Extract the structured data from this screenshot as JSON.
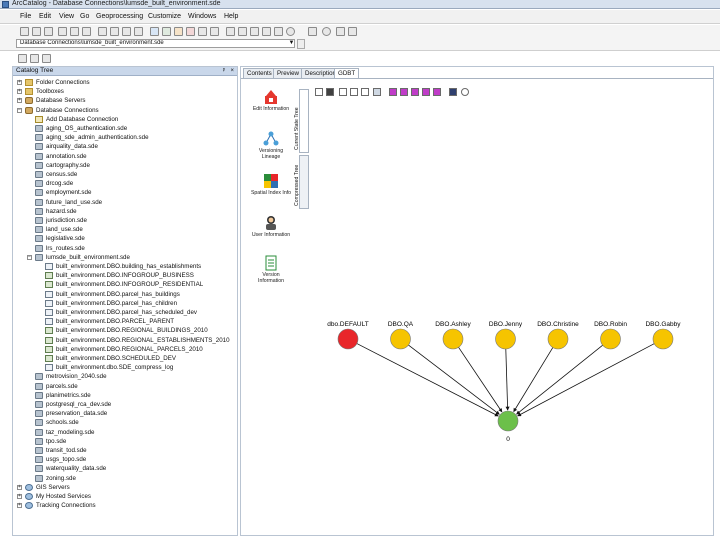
{
  "window": {
    "title": "ArcCatalog - Database Connections\\lumsde_built_environment.sde"
  },
  "menu": [
    "File",
    "Edit",
    "View",
    "Go",
    "Geoprocessing",
    "Customize",
    "Windows",
    "Help"
  ],
  "location": {
    "value": "Database Connections\\lumsde_built_environment.sde"
  },
  "catalog": {
    "title": "Catalog Tree",
    "pin": "ᵖ",
    "close": "×",
    "items": [
      {
        "label": "Folder Connections",
        "icon": "folder",
        "exp": "+"
      },
      {
        "label": "Toolboxes",
        "icon": "folder",
        "exp": "+"
      },
      {
        "label": "Database Servers",
        "icon": "db",
        "exp": "+"
      },
      {
        "label": "Database Connections",
        "icon": "db",
        "exp": "−"
      },
      {
        "label": "Add Database Connection",
        "icon": "addconn"
      },
      {
        "label": "aging_OS_authentication.sde",
        "icon": "sde"
      },
      {
        "label": "aging_sde_admin_authentication.sde",
        "icon": "sde"
      },
      {
        "label": "airquality_data.sde",
        "icon": "sde"
      },
      {
        "label": "annotation.sde",
        "icon": "sde"
      },
      {
        "label": "cartography.sde",
        "icon": "sde"
      },
      {
        "label": "census.sde",
        "icon": "sde"
      },
      {
        "label": "drcog.sde",
        "icon": "sde"
      },
      {
        "label": "employment.sde",
        "icon": "sde"
      },
      {
        "label": "future_land_use.sde",
        "icon": "sde"
      },
      {
        "label": "hazard.sde",
        "icon": "sde"
      },
      {
        "label": "jurisdiction.sde",
        "icon": "sde"
      },
      {
        "label": "land_use.sde",
        "icon": "sde"
      },
      {
        "label": "legislative.sde",
        "icon": "sde"
      },
      {
        "label": "lrs_routes.sde",
        "icon": "sde"
      },
      {
        "label": "lumsde_built_environment.sde",
        "icon": "sde",
        "exp": "−"
      },
      {
        "label": "built_environment.DBO.building_has_establishments",
        "icon": "table"
      },
      {
        "label": "built_environment.DBO.INFOGROUP_BUSINESS",
        "icon": "fc"
      },
      {
        "label": "built_environment.DBO.INFOGROUP_RESIDENTIAL",
        "icon": "fc"
      },
      {
        "label": "built_environment.DBO.parcel_has_buildings",
        "icon": "table"
      },
      {
        "label": "built_environment.DBO.parcel_has_children",
        "icon": "table"
      },
      {
        "label": "built_environment.DBO.parcel_has_scheduled_dev",
        "icon": "table"
      },
      {
        "label": "built_environment.DBO.PARCEL_PARENT",
        "icon": "table"
      },
      {
        "label": "built_environment.DBO.REGIONAL_BUILDINGS_2010",
        "icon": "fc"
      },
      {
        "label": "built_environment.DBO.REGIONAL_ESTABLISHMENTS_2010",
        "icon": "fc"
      },
      {
        "label": "built_environment.DBO.REGIONAL_PARCELS_2010",
        "icon": "fc"
      },
      {
        "label": "built_environment.DBO.SCHEDULED_DEV",
        "icon": "fc"
      },
      {
        "label": "built_environment.dbo.SDE_compress_log",
        "icon": "table"
      },
      {
        "label": "metrovision_2040.sde",
        "icon": "sde"
      },
      {
        "label": "parcels.sde",
        "icon": "sde"
      },
      {
        "label": "planimetrics.sde",
        "icon": "sde"
      },
      {
        "label": "postgresql_rca_dev.sde",
        "icon": "sde"
      },
      {
        "label": "preservation_data.sde",
        "icon": "sde"
      },
      {
        "label": "schools.sde",
        "icon": "sde"
      },
      {
        "label": "taz_modeling.sde",
        "icon": "sde"
      },
      {
        "label": "tpo.sde",
        "icon": "sde"
      },
      {
        "label": "transit_tod.sde",
        "icon": "sde"
      },
      {
        "label": "usgs_topo.sde",
        "icon": "sde"
      },
      {
        "label": "waterquality_data.sde",
        "icon": "sde"
      },
      {
        "label": "zoning.sde",
        "icon": "sde"
      },
      {
        "label": "GIS Servers",
        "icon": "gis",
        "exp": "+"
      },
      {
        "label": "My Hosted Services",
        "icon": "gis",
        "exp": "+"
      },
      {
        "label": "Tracking Connections",
        "icon": "gis",
        "exp": "+"
      }
    ]
  },
  "tabs": [
    "Contents",
    "Preview",
    "Description",
    "GDBT"
  ],
  "active_tab": "GDBT",
  "vtabs": [
    "Current State Tree",
    "Compressed Tree"
  ],
  "tools": [
    {
      "label": "Edit Information",
      "icon": "edit-info-icon"
    },
    {
      "label": "Versioning Lineage",
      "icon": "lineage-icon"
    },
    {
      "label": "Spatial Index Info",
      "icon": "spatial-index-icon"
    },
    {
      "label": "User Information",
      "icon": "user-info-icon"
    },
    {
      "label": "Version Information",
      "icon": "version-info-icon"
    }
  ],
  "graph": {
    "nodes": [
      {
        "label": "dbo.DEFAULT",
        "color": "#e8262a"
      },
      {
        "label": "DBO.QA",
        "color": "#f6c400"
      },
      {
        "label": "DBO.Ashley",
        "color": "#f6c400"
      },
      {
        "label": "DBO.Jenny",
        "color": "#f6c400"
      },
      {
        "label": "DBO.Christine",
        "color": "#f6c400"
      },
      {
        "label": "DBO.Robin",
        "color": "#f6c400"
      },
      {
        "label": "DBO.Gabby",
        "color": "#f6c400"
      }
    ],
    "root": {
      "label": "0",
      "color": "#6cc04a"
    }
  }
}
